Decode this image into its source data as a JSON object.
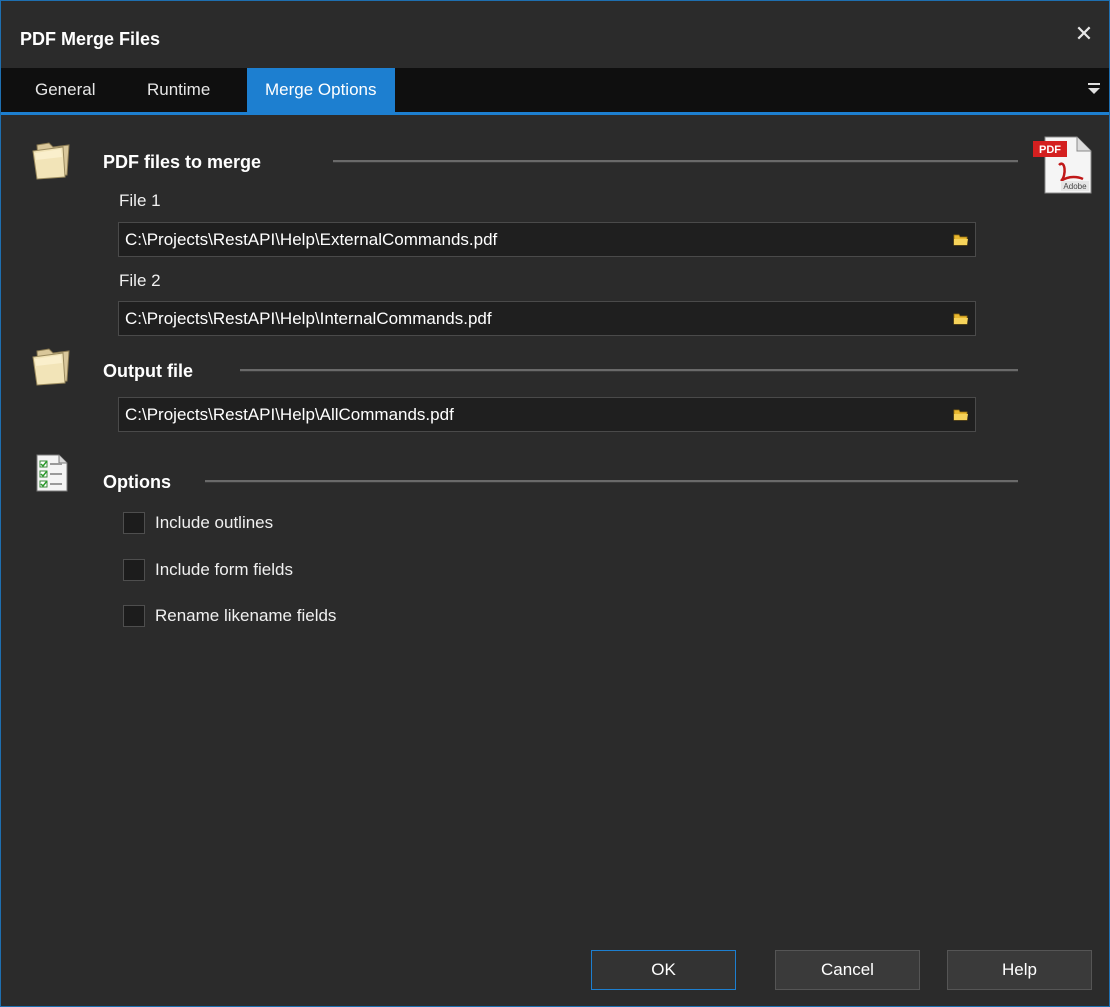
{
  "window": {
    "title": "PDF Merge Files",
    "close_glyph": "✕"
  },
  "tabs": [
    {
      "label": "General"
    },
    {
      "label": "Runtime"
    },
    {
      "label": "Merge Options"
    }
  ],
  "merge_section": {
    "title": "PDF files to merge",
    "file1": {
      "label": "File 1",
      "value": "C:\\Projects\\RestAPI\\Help\\ExternalCommands.pdf"
    },
    "file2": {
      "label": "File 2",
      "value": "C:\\Projects\\RestAPI\\Help\\InternalCommands.pdf"
    }
  },
  "output_section": {
    "title": "Output file",
    "value": "C:\\Projects\\RestAPI\\Help\\AllCommands.pdf"
  },
  "options_section": {
    "title": "Options",
    "checkboxes": [
      {
        "label": "Include outlines",
        "checked": false
      },
      {
        "label": "Include form fields",
        "checked": false
      },
      {
        "label": "Rename likename fields",
        "checked": false
      }
    ]
  },
  "pdf_logo": {
    "badge": "PDF",
    "brand": "Adobe"
  },
  "buttons": {
    "ok": "OK",
    "cancel": "Cancel",
    "help": "Help"
  },
  "colors": {
    "accent": "#1d7fd0",
    "background": "#2b2b2b",
    "tabbar": "#0f0f0f"
  }
}
